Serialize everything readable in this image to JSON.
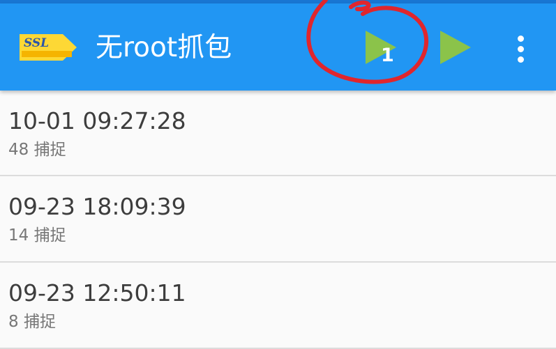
{
  "app": {
    "title": "无root抓包",
    "logo_text": "SSL"
  },
  "toolbar": {
    "start_vpn_icon": "play-icon",
    "start_vpn_badge": "1",
    "start_icon": "play-icon",
    "overflow_icon": "more-vert-icon",
    "colors": {
      "bar": "#2196f3",
      "play": "#8bc34a",
      "logo": "#fdd835",
      "annotation": "#e0262d"
    }
  },
  "sessions": [
    {
      "time": "10-01 09:27:28",
      "captures": "48 捕捉"
    },
    {
      "time": "09-23 18:09:39",
      "captures": "14 捕捉"
    },
    {
      "time": "09-23 12:50:11",
      "captures": "8 捕捉"
    }
  ]
}
